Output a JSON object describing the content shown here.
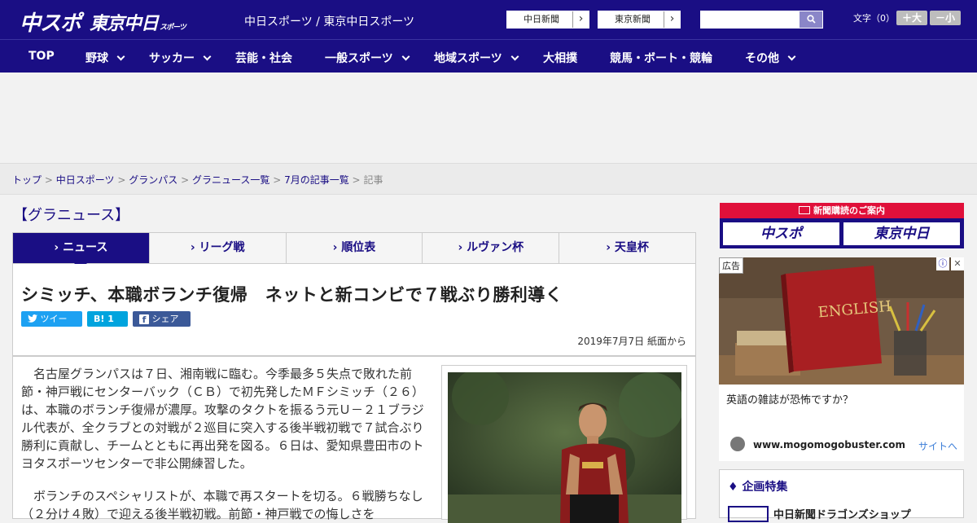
{
  "header": {
    "logo_chuspo": "中スポ",
    "logo_tokyo": "東京中日",
    "logo_tokyo_small": "スポーツ",
    "site_title": "中日スポーツ / 東京中日スポーツ",
    "ext_links": [
      "中日新聞",
      "東京新聞"
    ],
    "search_placeholder": "",
    "fontsize_label": "文字（0）",
    "fontsize_plus": "＋大",
    "fontsize_minus": "－小"
  },
  "nav": {
    "items": [
      "TOP",
      "野球",
      "サッカー",
      "芸能・社会",
      "一般スポーツ",
      "地域スポーツ",
      "大相撲",
      "競馬・ボート・競輪",
      "その他"
    ]
  },
  "breadcrumb": {
    "items": [
      "トップ",
      "中日スポーツ",
      "グランパス",
      "グラニュース一覧",
      "7月の記事一覧"
    ],
    "current": "記事",
    "separator": ">"
  },
  "section_title": "【グラニュース】",
  "tabs": [
    "ニュース",
    "リーグ戦",
    "順位表",
    "ルヴァン杯",
    "天皇杯"
  ],
  "article": {
    "headline": "シミッチ、本職ボランチ復帰　ネットと新コンビで７戦ぶり勝利導く",
    "share": {
      "tweet": "ツイート",
      "hatena": "B! 1",
      "facebook": "シェア 2"
    },
    "dateline": "2019年7月7日 紙面から",
    "para1": "名古屋グランパスは７日、湘南戦に臨む。今季最多５失点で敗れた前節・神戸戦にセンターバック（ＣＢ）で初先発したＭＦシミッチ（２６）は、本職のボランチ復帰が濃厚。攻撃のタクトを振るう元Ｕ－２１ブラジル代表が、全クラブとの対戦が２巡目に突入する後半戦初戦で７試合ぶり勝利に貢献し、チームとともに再出発を図る。６日は、愛知県豊田市のトヨタスポーツセンターで非公開練習した。",
    "para2": "ボランチのスペシャリストが、本職で再スタートを切る。６戦勝ちなし（２分け４敗）で迎える後半戦初戦。前節・神戸戦での悔しさを"
  },
  "sidebar": {
    "sub_head": "新聞購読のご案内",
    "sub_chuspo": "中スポ",
    "sub_tokyo": "東京中日",
    "ad_label": "広告",
    "ad_text": "英語の雑誌が恐怖ですか？",
    "ad_domain": "www.mogomogobuster.com",
    "ad_cta": "サイトへ",
    "ad_book_title": "ENGLISH",
    "feature_title": "企画特集",
    "feature_item": "中日新聞ドラゴンズショップ"
  },
  "colors": {
    "brand": "#1a0e84",
    "subscribe_red": "#e0103a"
  }
}
